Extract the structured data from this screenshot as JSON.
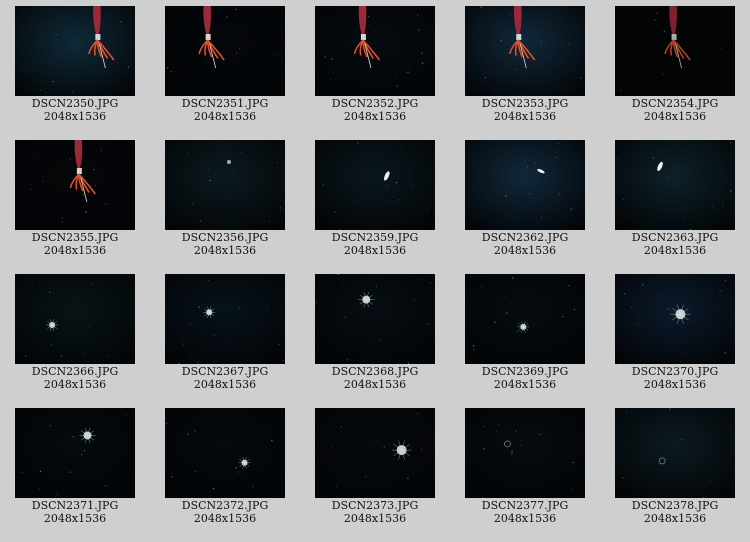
{
  "gallery": {
    "items": [
      {
        "filename": "DSCN2350.JPG",
        "dimensions": "2048x1536",
        "scene": "squid",
        "bg": "#0f2a38"
      },
      {
        "filename": "DSCN2351.JPG",
        "dimensions": "2048x1536",
        "scene": "squid",
        "bg": "#04070a"
      },
      {
        "filename": "DSCN2352.JPG",
        "dimensions": "2048x1536",
        "scene": "squid",
        "bg": "#060b10"
      },
      {
        "filename": "DSCN2353.JPG",
        "dimensions": "2048x1536",
        "scene": "squid",
        "bg": "#11283a"
      },
      {
        "filename": "DSCN2354.JPG",
        "dimensions": "2048x1536",
        "scene": "squid-dim",
        "bg": "#030507"
      },
      {
        "filename": "DSCN2355.JPG",
        "dimensions": "2048x1536",
        "scene": "squid",
        "bg": "#040609"
      },
      {
        "filename": "DSCN2356.JPG",
        "dimensions": "2048x1536",
        "scene": "speck",
        "bg": "#0c1a20"
      },
      {
        "filename": "DSCN2359.JPG",
        "dimensions": "2048x1536",
        "scene": "bright-sliver",
        "bg": "#0a171d"
      },
      {
        "filename": "DSCN2362.JPG",
        "dimensions": "2048x1536",
        "scene": "sliver",
        "bg": "#11283a"
      },
      {
        "filename": "DSCN2363.JPG",
        "dimensions": "2048x1536",
        "scene": "bright-sliver",
        "bg": "#0d2129"
      },
      {
        "filename": "DSCN2366.JPG",
        "dimensions": "2048x1536",
        "scene": "small-jelly",
        "bg": "#081417"
      },
      {
        "filename": "DSCN2367.JPG",
        "dimensions": "2048x1536",
        "scene": "small-jelly",
        "bg": "#07121a"
      },
      {
        "filename": "DSCN2368.JPG",
        "dimensions": "2048x1536",
        "scene": "jelly",
        "bg": "#060d12"
      },
      {
        "filename": "DSCN2369.JPG",
        "dimensions": "2048x1536",
        "scene": "small-jelly",
        "bg": "#050b10"
      },
      {
        "filename": "DSCN2370.JPG",
        "dimensions": "2048x1536",
        "scene": "bright-jelly",
        "bg": "#0c1a2c"
      },
      {
        "filename": "DSCN2371.JPG",
        "dimensions": "2048x1536",
        "scene": "jelly",
        "bg": "#050a0e"
      },
      {
        "filename": "DSCN2372.JPG",
        "dimensions": "2048x1536",
        "scene": "small-jelly",
        "bg": "#05090c"
      },
      {
        "filename": "DSCN2373.JPG",
        "dimensions": "2048x1536",
        "scene": "bright-jelly",
        "bg": "#06090c"
      },
      {
        "filename": "DSCN2377.JPG",
        "dimensions": "2048x1536",
        "scene": "ring",
        "bg": "#060b0e"
      },
      {
        "filename": "DSCN2378.JPG",
        "dimensions": "2048x1536",
        "scene": "ring",
        "bg": "#0c1a20"
      }
    ]
  }
}
